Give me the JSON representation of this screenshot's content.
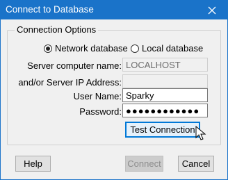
{
  "window": {
    "title": "Connect to Database",
    "title_bar_color": "#1a73c9"
  },
  "group": {
    "legend": "Connection Options",
    "options": [
      {
        "label": "Network database",
        "selected": true
      },
      {
        "label": "Local database",
        "selected": false
      }
    ]
  },
  "fields": {
    "server_name_label": "Server computer name:",
    "server_name_value": "LOCALHOST",
    "server_ip_label": "and/or Server IP Address:",
    "server_ip_value": "",
    "username_label": "User Name:",
    "username_value": "Sparky",
    "password_label": "Password:",
    "password_value": "●●●●●●●●●●●●"
  },
  "buttons": {
    "test": "Test Connection",
    "help": "Help",
    "connect": "Connect",
    "cancel": "Cancel"
  },
  "icons": {
    "close": "close-icon",
    "cursor": "mouse-pointer-icon"
  }
}
